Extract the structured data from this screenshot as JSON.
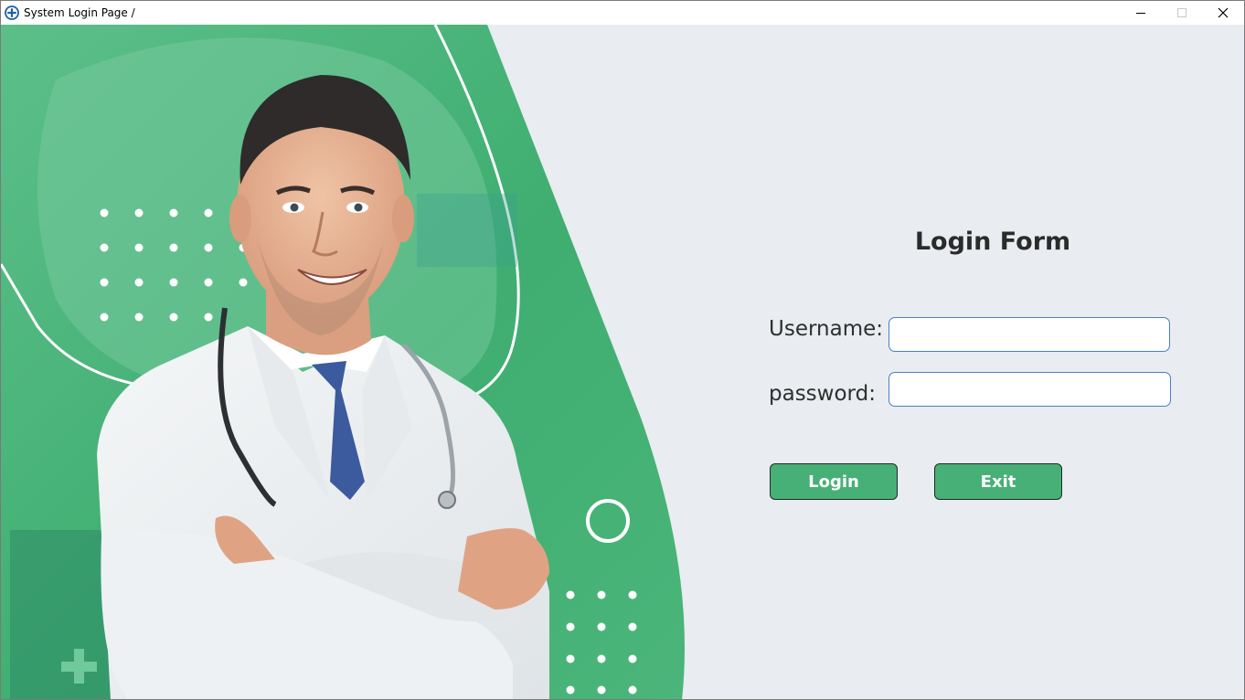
{
  "window": {
    "title": "System Login Page /"
  },
  "form": {
    "heading": "Login Form",
    "username_label": "Username:",
    "password_label": "password:",
    "username_value": "",
    "password_value": "",
    "login_label": "Login",
    "exit_label": "Exit"
  },
  "colors": {
    "accent_green": "#47b077",
    "panel_background": "#e9ecf0",
    "input_border": "#4a7fc8"
  },
  "icons": {
    "app": "medical-cross-circle-icon",
    "minimize": "minimize-icon",
    "maximize": "maximize-icon",
    "close": "close-icon"
  }
}
